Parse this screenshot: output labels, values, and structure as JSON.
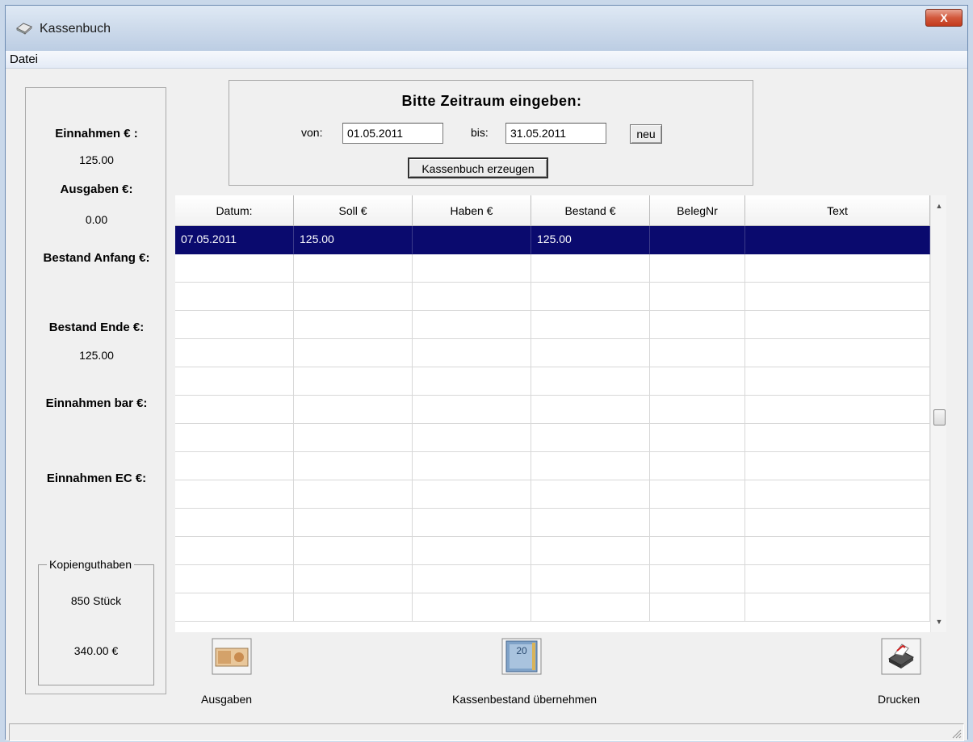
{
  "window": {
    "title": "Kassenbuch",
    "close_glyph": "X"
  },
  "menu": {
    "datei": "Datei"
  },
  "summary": {
    "einnahmen_label": "Einnahmen € :",
    "einnahmen_value": "125.00",
    "ausgaben_label": "Ausgaben €:",
    "ausgaben_value": "0.00",
    "bestand_anfang_label": "Bestand Anfang €:",
    "bestand_ende_label": "Bestand Ende €:",
    "bestand_ende_value": "125.00",
    "einnahmen_bar_label": "Einnahmen bar €:",
    "einnahmen_ec_label": "Einnahmen EC €:"
  },
  "kopien": {
    "legend": "Kopienguthaben",
    "stueck": "850 Stück",
    "betrag": "340.00 €"
  },
  "zeitraum": {
    "title": "Bitte Zeitraum eingeben:",
    "von_label": "von:",
    "von_value": "01.05.2011",
    "bis_label": "bis:",
    "bis_value": "31.05.2011",
    "neu_label": "neu",
    "erzeugen_label": "Kassenbuch erzeugen"
  },
  "table": {
    "columns": [
      "Datum:",
      "Soll €",
      "Haben €",
      "Bestand €",
      "BelegNr",
      "Text"
    ],
    "rows": [
      [
        "07.05.2011",
        "125.00",
        "",
        "125.00",
        "",
        ""
      ]
    ],
    "selected_row": 0,
    "empty_row_count": 13
  },
  "actions": {
    "ausgaben_label": "Ausgaben",
    "kassenbestand_label": "Kassenbestand übernehmen",
    "drucken_label": "Drucken"
  },
  "icons": {
    "app": "cash-book-icon",
    "ausgaben": "banknote-icon",
    "kassenbestand": "euro-banknote-icon",
    "drucken": "printer-icon",
    "scroll_up": "scroll-up-arrow-icon",
    "scroll_down": "scroll-down-arrow-icon"
  },
  "colors": {
    "selection": "#0a0a6e",
    "close_button": "#c33a1c"
  }
}
